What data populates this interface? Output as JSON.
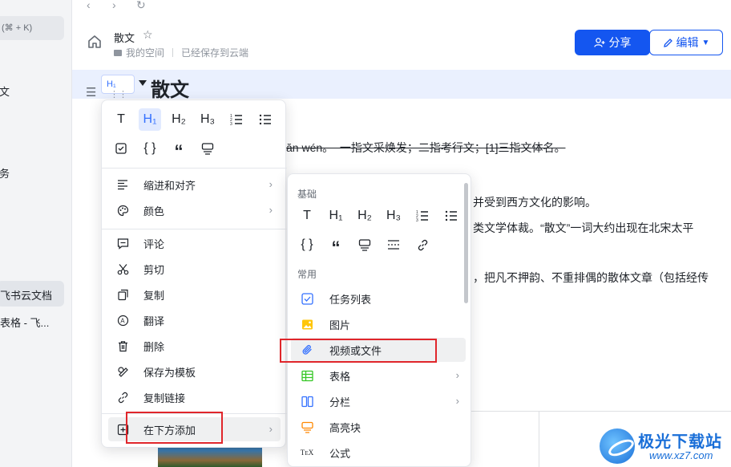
{
  "sidebar": {
    "search_shortcut": "(⌘ + K)",
    "fragments": [
      "文",
      "务"
    ],
    "active_item": "飞书云文档",
    "item2": "表格 - 飞..."
  },
  "doc": {
    "title": "散文",
    "breadcrumb_space": "我的空间",
    "save_status": "已经保存到云端",
    "share_label": "分享",
    "edit_label": "编辑",
    "heading_badge": "H₁",
    "heading_text": "散文",
    "lines": [
      "ăn wén。  一指文采焕发；二指考行文；[1]三指文体名。",
      "并受到西方文化的影响。",
      "类文学体裁。“散文”一词大约出现在北宋太平",
      "，把凡不押韵、不重排偶的散体文章（包括经传"
    ]
  },
  "menu": {
    "format_row1": [
      "T",
      "H₁",
      "H₂",
      "H₃",
      "ordered-list-icon",
      "bullet-list-icon"
    ],
    "format_row2": [
      "checkbox-icon",
      "{ }",
      "“",
      "callout-icon"
    ],
    "items": [
      {
        "label": "缩进和对齐",
        "icon": "align-icon",
        "has_sub": true
      },
      {
        "label": "颜色",
        "icon": "palette-icon",
        "has_sub": true
      },
      {
        "label": "评论",
        "icon": "comment-icon",
        "has_sub": false
      },
      {
        "label": "剪切",
        "icon": "scissors-icon",
        "has_sub": false
      },
      {
        "label": "复制",
        "icon": "copy-icon",
        "has_sub": false
      },
      {
        "label": "翻译",
        "icon": "translate-icon",
        "has_sub": false
      },
      {
        "label": "删除",
        "icon": "trash-icon",
        "has_sub": false
      },
      {
        "label": "保存为模板",
        "icon": "template-icon",
        "has_sub": false
      },
      {
        "label": "复制链接",
        "icon": "link-icon",
        "has_sub": false
      },
      {
        "label": "在下方添加",
        "icon": "add-below-icon",
        "has_sub": true
      }
    ]
  },
  "submenu": {
    "basic_header": "基础",
    "common_header": "常用",
    "basic_row1": [
      "T",
      "H₁",
      "H₂",
      "H₃",
      "ordered-list-icon",
      "bullet-list-icon"
    ],
    "basic_row2": [
      "{ }",
      "“",
      "callout-icon",
      "divider-icon",
      "link-icon"
    ],
    "items": [
      {
        "label": "任务列表",
        "icon": "task-list-icon",
        "color": "#3370ff",
        "has_sub": false
      },
      {
        "label": "图片",
        "icon": "image-icon",
        "color": "#ffc60a",
        "has_sub": false
      },
      {
        "label": "视频或文件",
        "icon": "attachment-icon",
        "color": "#3370ff",
        "has_sub": false
      },
      {
        "label": "表格",
        "icon": "table-icon",
        "color": "#34c724",
        "has_sub": true
      },
      {
        "label": "分栏",
        "icon": "columns-icon",
        "color": "#3370ff",
        "has_sub": true
      },
      {
        "label": "高亮块",
        "icon": "highlight-block-icon",
        "color": "#ff8800",
        "has_sub": false
      },
      {
        "label": "公式",
        "icon": "formula-icon",
        "color": "#1f2329",
        "has_sub": false
      }
    ]
  },
  "watermark": {
    "title": "极光下载站",
    "url": "www.xz7.com"
  },
  "colors": {
    "accent": "#1456f0",
    "highlight_box": "#e0262b",
    "heading_bg": "#eaf0fe"
  }
}
